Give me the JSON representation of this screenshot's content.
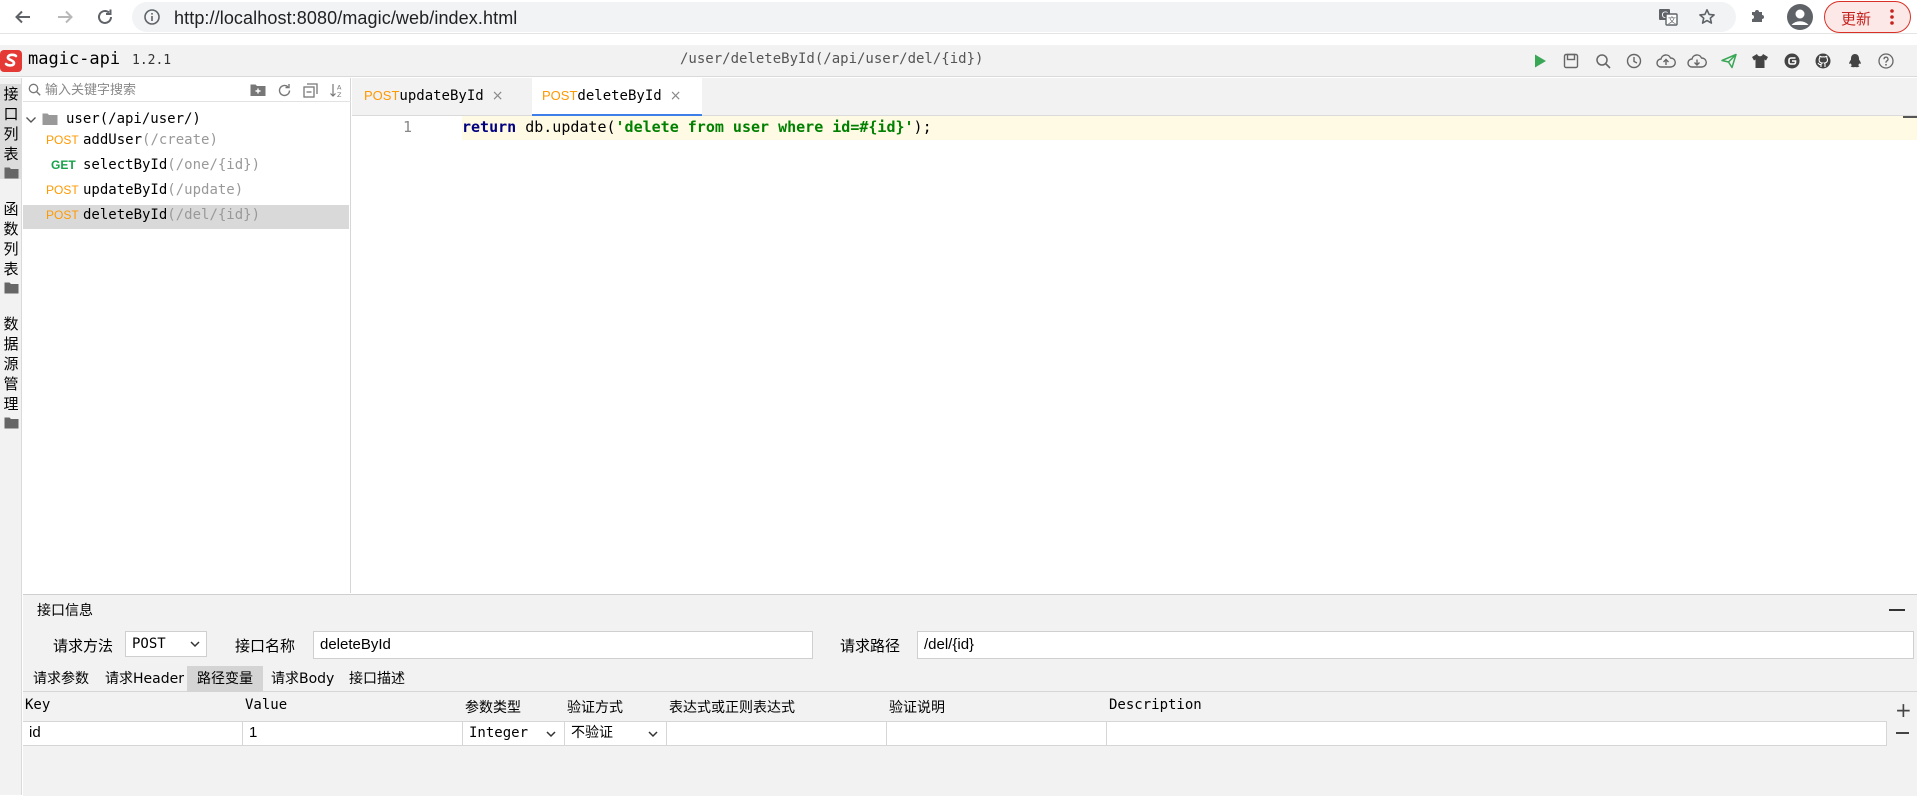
{
  "browser": {
    "url": "http://localhost:8080/magic/web/index.html",
    "update_label": "更新"
  },
  "app": {
    "name": "magic-api",
    "version": "1.2.1",
    "current_path": "/user/deleteById(/api/user/del/{id})",
    "toolbar": [
      "run-icon",
      "save-icon",
      "search-icon",
      "history-icon",
      "upload-icon",
      "download-icon",
      "push-icon",
      "skin-icon",
      "gitee-icon",
      "github-icon",
      "qq-icon",
      "help-icon"
    ]
  },
  "side_tabs": [
    {
      "label": "接口列表",
      "chars": [
        "接",
        "口",
        "列",
        "表"
      ]
    },
    {
      "label": "函数列表",
      "chars": [
        "函",
        "数",
        "列",
        "表"
      ]
    },
    {
      "label": "数据源管理",
      "chars": [
        "数",
        "据",
        "源",
        "管",
        "理"
      ]
    }
  ],
  "tree": {
    "search_placeholder": "输入关键字搜索",
    "group": {
      "name": "user",
      "path": "(/api/user/)"
    },
    "items": [
      {
        "method": "POST",
        "name": "addUser",
        "path": "(/create)"
      },
      {
        "method": "GET",
        "name": "selectById",
        "path": "(/one/{id})"
      },
      {
        "method": "POST",
        "name": "updateById",
        "path": "(/update)"
      },
      {
        "method": "POST",
        "name": "deleteById",
        "path": "(/del/{id})"
      }
    ]
  },
  "editor_tabs": [
    {
      "method": "POST",
      "name": "updateById",
      "close": "×"
    },
    {
      "method": "POST",
      "name": "deleteById",
      "close": "×"
    }
  ],
  "editor": {
    "line_number": "1",
    "code_keyword": "return",
    "code_call": " db.update(",
    "code_string": "'delete from user where id=#{id}'",
    "code_end": ");"
  },
  "info": {
    "title": "接口信息",
    "method_label": "请求方法",
    "method_value": "POST",
    "name_label": "接口名称",
    "name_value": "deleteById",
    "path_label": "请求路径",
    "path_value": "/del/{id}",
    "tabs": [
      "请求参数",
      "请求Header",
      "路径变量",
      "请求Body",
      "接口描述"
    ],
    "active_tab": "路径变量"
  },
  "path_vars": {
    "columns": [
      "Key",
      "Value",
      "参数类型",
      "验证方式",
      "表达式或正则表达式",
      "验证说明",
      "Description"
    ],
    "rows": [
      {
        "key": "id",
        "value": "1",
        "type": "Integer",
        "validation": "不验证",
        "expression": "",
        "validation_desc": "",
        "description": ""
      }
    ],
    "add": "+"
  }
}
